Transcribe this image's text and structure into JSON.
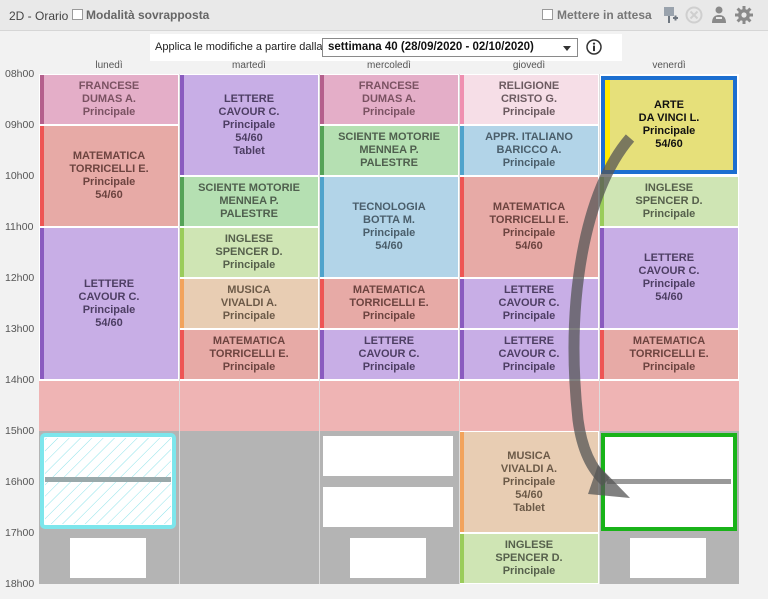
{
  "header": {
    "title": "2D - Orario",
    "overlap_label": "Modalità sovrapposta",
    "wait_label": "Mettere in attesa"
  },
  "apply": {
    "label": "Applica le modifiche a partire dalla",
    "week_value": "settimana 40 (28/09/2020 - 02/10/2020)"
  },
  "days": [
    "lunedì",
    "martedì",
    "mercoledì",
    "giovedì",
    "venerdì"
  ],
  "hours": [
    "08h00",
    "09h00",
    "10h00",
    "11h00",
    "12h00",
    "13h00",
    "14h00",
    "15h00",
    "16h00",
    "17h00",
    "18h00"
  ],
  "lessons": [
    {
      "lines": [
        "FRANCESE",
        "DUMAS A.",
        "Principale"
      ]
    },
    {
      "lines": [
        "MATEMATICA",
        "TORRICELLI E.",
        "Principale",
        "54/60"
      ]
    },
    {
      "lines": [
        "LETTERE",
        "CAVOUR C.",
        "Principale",
        "54/60"
      ]
    },
    {
      "lines": [
        "LETTERE",
        "CAVOUR C.",
        "Principale",
        "54/60",
        "Tablet"
      ]
    },
    {
      "lines": [
        "SCIENTE MOTORIE",
        "MENNEA P.",
        "PALESTRE"
      ]
    },
    {
      "lines": [
        "INGLESE",
        "SPENCER D.",
        "Principale"
      ]
    },
    {
      "lines": [
        "MUSICA",
        "VIVALDI A.",
        "Principale"
      ]
    },
    {
      "lines": [
        "MATEMATICA",
        "TORRICELLI E.",
        "Principale"
      ]
    },
    {
      "lines": [
        "FRANCESE",
        "DUMAS A.",
        "Principale"
      ]
    },
    {
      "lines": [
        "SCIENTE MOTORIE",
        "MENNEA P.",
        "PALESTRE"
      ]
    },
    {
      "lines": [
        "TECNOLOGIA",
        "BOTTA M.",
        "Principale",
        "54/60"
      ]
    },
    {
      "lines": [
        "MATEMATICA",
        "TORRICELLI E.",
        "Principale"
      ]
    },
    {
      "lines": [
        "LETTERE",
        "CAVOUR C.",
        "Principale"
      ]
    },
    {
      "lines": [
        "RELIGIONE",
        "CRISTO G.",
        "Principale"
      ]
    },
    {
      "lines": [
        "APPR. ITALIANO",
        "BARICCO A.",
        "Principale"
      ]
    },
    {
      "lines": [
        "MATEMATICA",
        "TORRICELLI E.",
        "Principale",
        "54/60"
      ]
    },
    {
      "lines": [
        "LETTERE",
        "CAVOUR C.",
        "Principale"
      ]
    },
    {
      "lines": [
        "LETTERE",
        "CAVOUR C.",
        "Principale"
      ]
    },
    {
      "lines": [
        "MUSICA",
        "VIVALDI A.",
        "Principale",
        "54/60",
        "Tablet"
      ]
    },
    {
      "lines": [
        "INGLESE",
        "SPENCER D.",
        "Principale"
      ]
    },
    {
      "lines": [
        "ARTE",
        "DA VINCI L.",
        "Principale",
        "54/60"
      ]
    },
    {
      "lines": [
        "INGLESE",
        "SPENCER D.",
        "Principale"
      ]
    },
    {
      "lines": [
        "LETTERE",
        "CAVOUR C.",
        "Principale",
        "54/60"
      ]
    },
    {
      "lines": [
        "MATEMATICA",
        "TORRICELLI E.",
        "Principale"
      ]
    }
  ],
  "colors": {
    "selected_border": "#1c6fd0",
    "target_border": "#19b319",
    "hatched_border": "#7de6ec"
  },
  "icons": [
    "pin-icon",
    "cancel-icon",
    "user-icon",
    "gear-icon",
    "info-icon"
  ]
}
